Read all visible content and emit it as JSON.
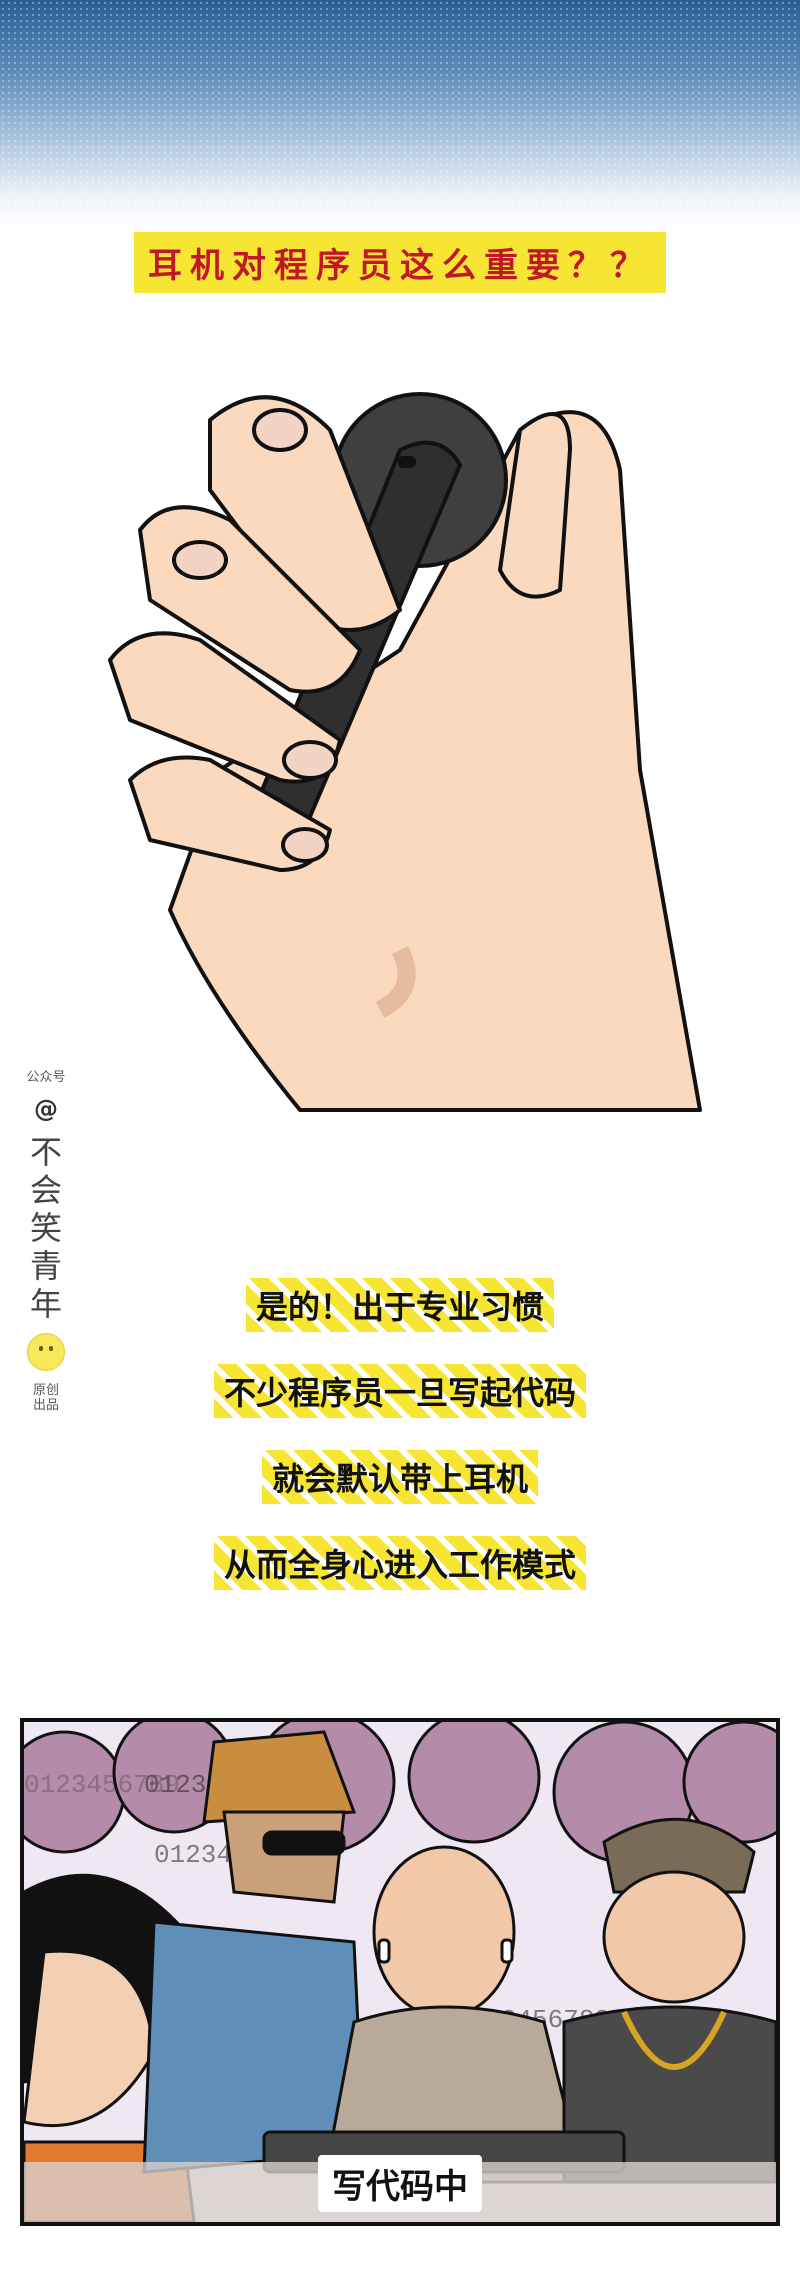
{
  "header": {
    "title": "耳机对程序员这么重要？？"
  },
  "side_brand": {
    "label_top": "公众号",
    "at_symbol": "@",
    "brand_chars": [
      "不",
      "会",
      "笑",
      "青",
      "年"
    ],
    "icon": "smiley-icon",
    "label_bottom_1": "原创",
    "label_bottom_2": "出品"
  },
  "captions": [
    "是的！出于专业习惯",
    "不少程序员一旦写起代码",
    "就会默认带上耳机",
    "从而全身心进入工作模式"
  ],
  "panel": {
    "overlay_texts": [
      "0123456789",
      "0123456789",
      "0123456789",
      "0123456789",
      "0123456789"
    ],
    "caption": "写代码中"
  },
  "colors": {
    "title_bg": "#f7e534",
    "title_text": "#c0182a",
    "caption_stripe": "#f7e534",
    "skin": "#fbd9be",
    "earbud": "#3b3b3b"
  }
}
